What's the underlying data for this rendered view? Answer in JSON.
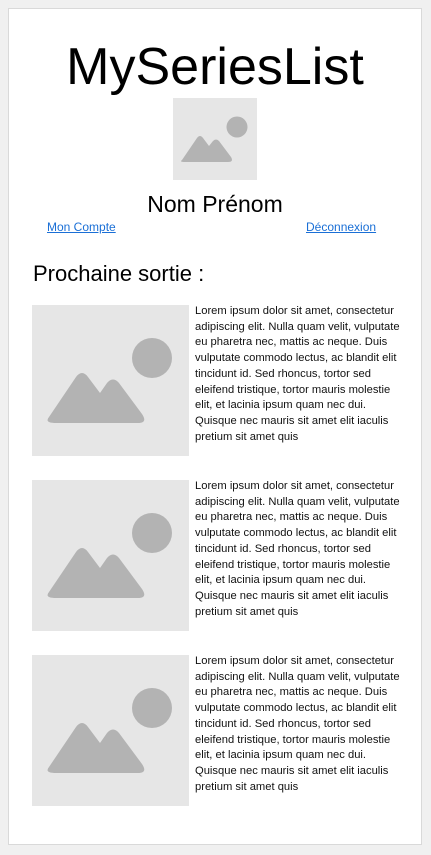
{
  "header": {
    "app_title": "MySeriesList",
    "avatar_icon": "image-placeholder-icon"
  },
  "user": {
    "name": "Nom Prénom",
    "account_link": "Mon Compte",
    "logout_link": "Déconnexion"
  },
  "section": {
    "title": "Prochaine sortie :"
  },
  "items": [
    {
      "thumbnail_icon": "image-placeholder-icon",
      "description": "Lorem ipsum dolor sit amet, consectetur adipiscing elit. Nulla quam velit, vulputate eu pharetra nec, mattis ac neque. Duis vulputate commodo lectus, ac blandit elit tincidunt id. Sed rhoncus, tortor sed eleifend tristique, tortor mauris molestie elit, et lacinia ipsum quam nec dui. Quisque nec mauris sit amet elit iaculis pretium sit amet quis"
    },
    {
      "thumbnail_icon": "image-placeholder-icon",
      "description": "Lorem ipsum dolor sit amet, consectetur adipiscing elit. Nulla quam velit, vulputate eu pharetra nec, mattis ac neque. Duis vulputate commodo lectus, ac blandit elit tincidunt id. Sed rhoncus, tortor sed eleifend tristique, tortor mauris molestie elit, et lacinia ipsum quam nec dui. Quisque nec mauris sit amet elit iaculis pretium sit amet quis"
    },
    {
      "thumbnail_icon": "image-placeholder-icon",
      "description": "Lorem ipsum dolor sit amet, consectetur adipiscing elit. Nulla quam velit, vulputate eu pharetra nec, mattis ac neque. Duis vulputate commodo lectus, ac blandit elit tincidunt id. Sed rhoncus, tortor sed eleifend tristique, tortor mauris molestie elit, et lacinia ipsum quam nec dui. Quisque nec mauris sit amet elit iaculis pretium sit amet quis"
    }
  ],
  "colors": {
    "placeholder_bg": "#e6e6e6",
    "placeholder_shape": "#b3b3b3",
    "link": "#1a6fd6"
  }
}
